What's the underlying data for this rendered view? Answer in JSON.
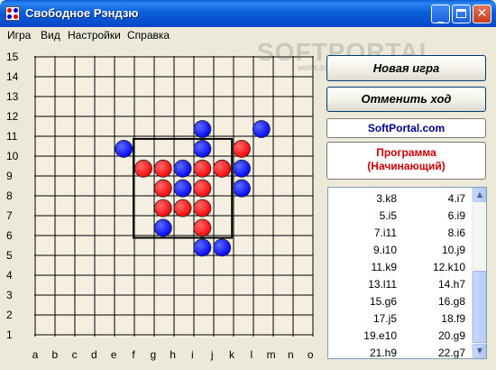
{
  "window": {
    "title": "Свободное Рэндзю"
  },
  "menu": [
    "Игра",
    "Вид",
    "Настройки",
    "Справка"
  ],
  "board": {
    "size": 15,
    "rows": [
      "15",
      "14",
      "13",
      "12",
      "11",
      "10",
      "9",
      "8",
      "7",
      "6",
      "5",
      "4",
      "3",
      "2",
      "1"
    ],
    "cols": [
      "a",
      "b",
      "c",
      "d",
      "e",
      "f",
      "g",
      "h",
      "i",
      "j",
      "k",
      "l",
      "m",
      "n",
      "o"
    ],
    "stone_colors": {
      "red": "#ff0000",
      "blue": "#0000ff"
    },
    "highlight_square": {
      "from": "f6",
      "to": "j10"
    },
    "stones": [
      {
        "color": "blue",
        "pos": "i11"
      },
      {
        "color": "blue",
        "pos": "l11"
      },
      {
        "color": "blue",
        "pos": "e10"
      },
      {
        "color": "blue",
        "pos": "i10"
      },
      {
        "color": "red",
        "pos": "k10"
      },
      {
        "color": "red",
        "pos": "f9"
      },
      {
        "color": "red",
        "pos": "g9"
      },
      {
        "color": "blue",
        "pos": "h9"
      },
      {
        "color": "red",
        "pos": "i9"
      },
      {
        "color": "red",
        "pos": "j9"
      },
      {
        "color": "blue",
        "pos": "k9"
      },
      {
        "color": "red",
        "pos": "g8"
      },
      {
        "color": "blue",
        "pos": "h8"
      },
      {
        "color": "red",
        "pos": "i8"
      },
      {
        "color": "blue",
        "pos": "k8"
      },
      {
        "color": "red",
        "pos": "g7"
      },
      {
        "color": "red",
        "pos": "h7"
      },
      {
        "color": "red",
        "pos": "i7"
      },
      {
        "color": "blue",
        "pos": "g6"
      },
      {
        "color": "red",
        "pos": "i6"
      },
      {
        "color": "blue",
        "pos": "i5"
      },
      {
        "color": "blue",
        "pos": "j5"
      }
    ]
  },
  "buttons": {
    "new_game": "Новая игра",
    "undo": "Отменить ход"
  },
  "info": {
    "site": "SoftPortal.com",
    "site_color": "#00008b",
    "player_line1": "Программа",
    "player_line2": "(Начинающий)",
    "player_color": "#cc0000"
  },
  "moves": [
    [
      "3.k8",
      "4.i7"
    ],
    [
      "5.i5",
      "6.i9"
    ],
    [
      "7.i11",
      "8.i6"
    ],
    [
      "9.i10",
      "10.j9"
    ],
    [
      "11.k9",
      "12.k10"
    ],
    [
      "13.l11",
      "14.h7"
    ],
    [
      "15.g6",
      "16.g8"
    ],
    [
      "17.j5",
      "18.f9"
    ],
    [
      "19.e10",
      "20.g9"
    ],
    [
      "21.h9",
      "22.g7"
    ]
  ],
  "watermark": {
    "main": "SOFTPORTAL",
    "sub": "www.softportal.com"
  }
}
